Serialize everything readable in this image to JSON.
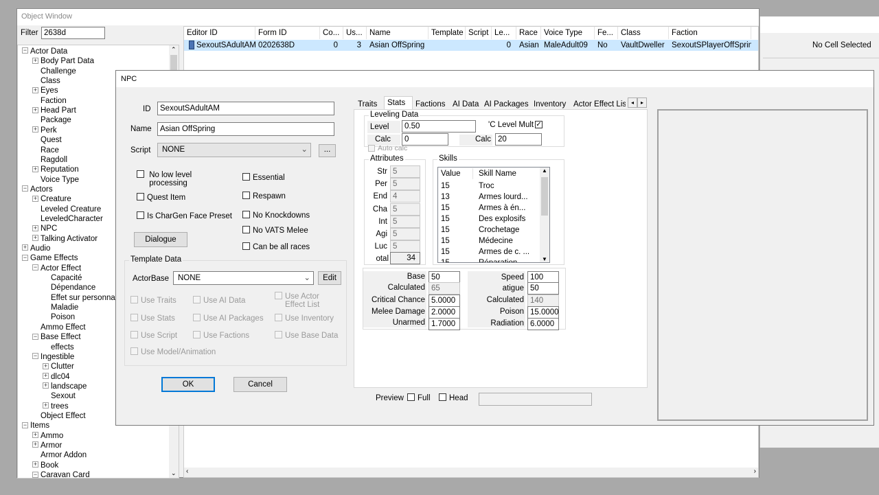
{
  "object_window": {
    "title": "Object Window",
    "filter_label": "Filter",
    "filter_value": "2638d",
    "tree": [
      {
        "label": "Actor Data",
        "level": 0,
        "exp": "-"
      },
      {
        "label": "Body Part Data",
        "level": 1,
        "exp": "+"
      },
      {
        "label": "Challenge",
        "level": 1,
        "exp": ""
      },
      {
        "label": "Class",
        "level": 1,
        "exp": ""
      },
      {
        "label": "Eyes",
        "level": 1,
        "exp": "+"
      },
      {
        "label": "Faction",
        "level": 1,
        "exp": ""
      },
      {
        "label": "Head Part",
        "level": 1,
        "exp": "+"
      },
      {
        "label": "Package",
        "level": 1,
        "exp": ""
      },
      {
        "label": "Perk",
        "level": 1,
        "exp": "+"
      },
      {
        "label": "Quest",
        "level": 1,
        "exp": ""
      },
      {
        "label": "Race",
        "level": 1,
        "exp": ""
      },
      {
        "label": "Ragdoll",
        "level": 1,
        "exp": ""
      },
      {
        "label": "Reputation",
        "level": 1,
        "exp": "+"
      },
      {
        "label": "Voice Type",
        "level": 1,
        "exp": ""
      },
      {
        "label": "Actors",
        "level": 0,
        "exp": "-"
      },
      {
        "label": "Creature",
        "level": 1,
        "exp": "+"
      },
      {
        "label": "Leveled Creature",
        "level": 1,
        "exp": ""
      },
      {
        "label": "LeveledCharacter",
        "level": 1,
        "exp": ""
      },
      {
        "label": "NPC",
        "level": 1,
        "exp": "+"
      },
      {
        "label": "Talking Activator",
        "level": 1,
        "exp": "+"
      },
      {
        "label": "Audio",
        "level": 0,
        "exp": "+"
      },
      {
        "label": "Game Effects",
        "level": 0,
        "exp": "-"
      },
      {
        "label": "Actor Effect",
        "level": 1,
        "exp": "-"
      },
      {
        "label": "Capacité",
        "level": 2,
        "exp": ""
      },
      {
        "label": "Dépendance",
        "level": 2,
        "exp": ""
      },
      {
        "label": "Effet sur personna",
        "level": 2,
        "exp": ""
      },
      {
        "label": "Maladie",
        "level": 2,
        "exp": ""
      },
      {
        "label": "Poison",
        "level": 2,
        "exp": ""
      },
      {
        "label": "Ammo Effect",
        "level": 1,
        "exp": ""
      },
      {
        "label": "Base Effect",
        "level": 1,
        "exp": "-"
      },
      {
        "label": "effects",
        "level": 2,
        "exp": ""
      },
      {
        "label": "Ingestible",
        "level": 1,
        "exp": "-"
      },
      {
        "label": "Clutter",
        "level": 2,
        "exp": "+"
      },
      {
        "label": "dlc04",
        "level": 2,
        "exp": "+"
      },
      {
        "label": "landscape",
        "level": 2,
        "exp": "+"
      },
      {
        "label": "Sexout",
        "level": 2,
        "exp": ""
      },
      {
        "label": "trees",
        "level": 2,
        "exp": "+"
      },
      {
        "label": "Object Effect",
        "level": 1,
        "exp": ""
      },
      {
        "label": "Items",
        "level": 0,
        "exp": "-"
      },
      {
        "label": "Ammo",
        "level": 1,
        "exp": "+"
      },
      {
        "label": "Armor",
        "level": 1,
        "exp": "+"
      },
      {
        "label": "Armor Addon",
        "level": 1,
        "exp": ""
      },
      {
        "label": "Book",
        "level": 1,
        "exp": "+"
      },
      {
        "label": "Caravan Card",
        "level": 1,
        "exp": "-"
      }
    ],
    "columns": [
      "Editor ID",
      "Form ID",
      "Co...",
      "Us...",
      "Name",
      "Template",
      "Script",
      "Le...",
      "Race",
      "Voice Type",
      "Fe...",
      "Class",
      "Faction"
    ],
    "row": [
      "SexoutSAdultAM",
      "0202638D",
      "0",
      "3",
      "Asian OffSpring",
      "",
      "",
      "0",
      "Asian",
      "MaleAdult09",
      "No",
      "VaultDweller",
      "SexoutSPlayerOffSpring"
    ]
  },
  "cell_window": {
    "status": "No Cell Selected"
  },
  "npc": {
    "title": "NPC",
    "id_label": "ID",
    "id_value": "SexoutSAdultAM",
    "name_label": "Name",
    "name_value": "Asian OffSpring",
    "script_label": "Script",
    "script_value": "NONE",
    "script_btn": "...",
    "cb_no_low_level": "No low level processing",
    "cb_quest_item": "Quest Item",
    "cb_chargen": "Is CharGen Face Preset",
    "cb_essential": "Essential",
    "cb_respawn": "Respawn",
    "cb_no_knockdowns": "No Knockdowns",
    "cb_no_vats": "No VATS Melee",
    "cb_all_races": "Can be all races",
    "dialogue_btn": "Dialogue",
    "template_title": "Template Data",
    "actorbase_label": "ActorBase",
    "actorbase_value": "NONE",
    "edit_btn": "Edit",
    "use_traits": "Use Traits",
    "use_ai_data": "Use AI Data",
    "use_actor_effect": "Use Actor Effect List",
    "use_stats": "Use Stats",
    "use_ai_packages": "Use AI Packages",
    "use_inventory": "Use Inventory",
    "use_script": "Use Script",
    "use_factions": "Use Factions",
    "use_base_data": "Use Base Data",
    "use_model": "Use Model/Animation",
    "ok_btn": "OK",
    "cancel_btn": "Cancel",
    "tabs": [
      "Traits",
      "Stats",
      "Factions",
      "AI Data",
      "AI Packages",
      "Inventory",
      "Actor Effect Lis"
    ],
    "active_tab": "Stats",
    "leveling_title": "Leveling Data",
    "level_label": "Level",
    "level_value": "0.50",
    "pc_level_mult": "'C Level Mult",
    "calc_label": "Calc",
    "calc_min": "0",
    "calc_max": "20",
    "auto_calc": "Auto calc",
    "attributes_title": "Attributes",
    "attributes": [
      {
        "label": "Str",
        "value": "5"
      },
      {
        "label": "Per",
        "value": "5"
      },
      {
        "label": "End",
        "value": "4"
      },
      {
        "label": "Cha",
        "value": "5"
      },
      {
        "label": "Int",
        "value": "5"
      },
      {
        "label": "Agi",
        "value": "5"
      },
      {
        "label": "Luc",
        "value": "5"
      }
    ],
    "total_label": "otal",
    "total_value": "34",
    "skills_title": "Skills",
    "skills_col_value": "Value",
    "skills_col_name": "Skill Name",
    "skills": [
      {
        "value": "15",
        "name": "Troc"
      },
      {
        "value": "13",
        "name": "Armes lourd..."
      },
      {
        "value": "15",
        "name": "Armes à én..."
      },
      {
        "value": "15",
        "name": "Des explosifs"
      },
      {
        "value": "15",
        "name": "Crochetage"
      },
      {
        "value": "15",
        "name": "Médecine"
      },
      {
        "value": "15",
        "name": "Armes de c. ..."
      },
      {
        "value": "15",
        "name": "Réparation"
      }
    ],
    "base_label": "Base",
    "base_value": "50",
    "calculated_label": "Calculated",
    "calculated_value": "65",
    "crit_label": "Critical Chance",
    "crit_value": "5.0000",
    "melee_label": "Melee Damage",
    "melee_value": "2.0000",
    "unarmed_label": "Unarmed",
    "unarmed_value": "1.7000",
    "speed_label": "Speed",
    "speed_value": "100",
    "fatigue_label": "atigue",
    "fatigue_value": "50",
    "calc2_label": "Calculated",
    "calc2_value": "140",
    "poison_label": "Poison",
    "poison_value": "15.0000",
    "radiation_label": "Radiation",
    "radiation_value": "6.0000",
    "preview_label": "Preview",
    "full_label": "Full",
    "head_label": "Head"
  }
}
